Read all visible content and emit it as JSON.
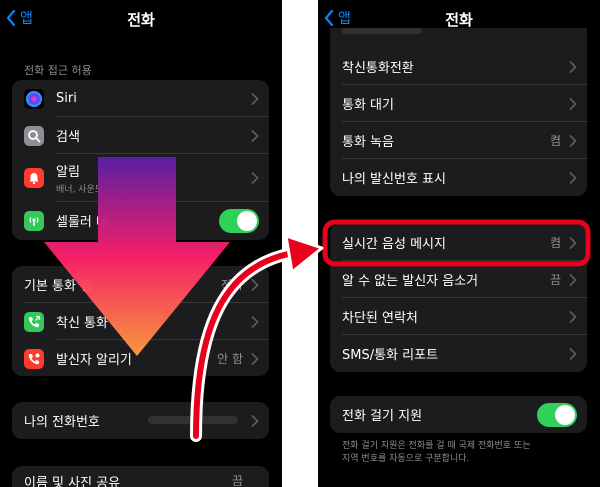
{
  "left": {
    "back_label": "앱",
    "title": "전화",
    "section_header": "전화 접근 허용",
    "access": {
      "siri": "Siri",
      "search": "검색",
      "notifications": "알림",
      "notifications_sub": "배너, 사운드",
      "cellular": "셀룰러 데"
    },
    "calls": {
      "default_app": "기본 통화 앱",
      "default_app_value": "전화",
      "call_forwarding": "착신 통화",
      "caller_id": "발신자 알리기",
      "caller_id_value": "안 함"
    },
    "my_number": "나의 전화번호",
    "share_name_photo": "이름 및 사진 공유",
    "share_value": "끔"
  },
  "right": {
    "back_label": "앱",
    "title": "전화",
    "items": {
      "forwarding": "착신통화전환",
      "waiting": "통화 대기",
      "recording": "통화 녹음",
      "recording_value": "켬",
      "show_caller_id": "나의 발신번호 표시",
      "live_voicemail": "실시간 음성 메시지",
      "live_voicemail_value": "켬",
      "silence_unknown": "알 수 없는 발신자 음소거",
      "silence_unknown_value": "끔",
      "blocked_contacts": "차단된 연락처",
      "sms_report": "SMS/통화 리포트",
      "dial_assist": "전화 걸기 지원"
    },
    "dial_assist_note_1": "전화 걸기 지원은 전화를 걸 때 국제 전화번호 또는",
    "dial_assist_note_2": "지역 번호를 자동으로 구분합니다."
  },
  "colors": {
    "accent_blue": "#0a84ff",
    "toggle_green": "#30d158",
    "highlight_red": "#e8001c",
    "arrow_top": "#5b1fa8",
    "arrow_mid": "#ff1f6b",
    "arrow_bottom": "#ff9e3d"
  },
  "icons": [
    "siri-icon",
    "search-icon",
    "notification-icon",
    "cellular-icon",
    "phone-forward-icon",
    "caller-alert-icon",
    "chevron-left-icon",
    "chevron-right-icon"
  ]
}
